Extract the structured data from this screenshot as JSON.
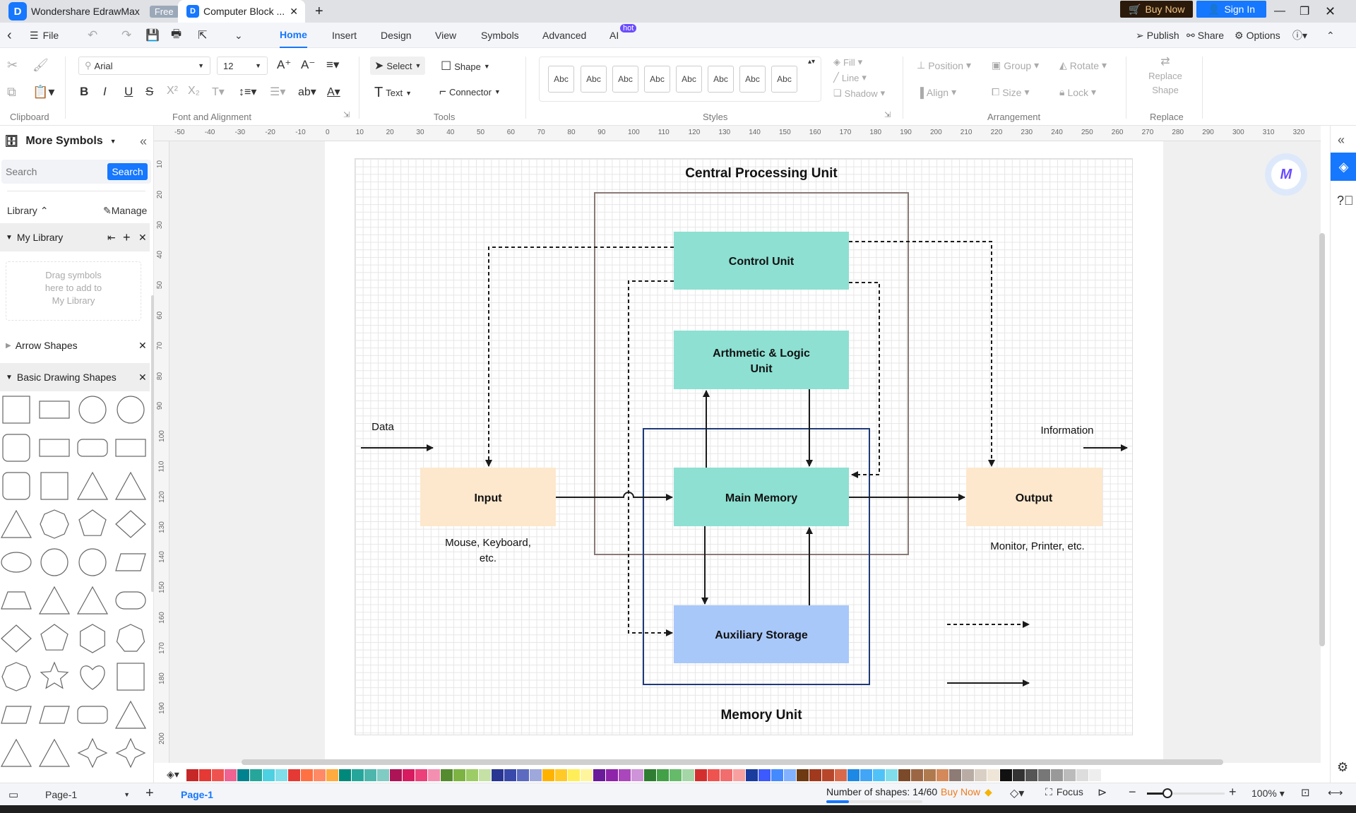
{
  "tabs": {
    "app": "Wondershare EdrawMax",
    "free_badge": "Free",
    "doc": "Computer Block ...",
    "buy": "Buy Now",
    "signin": "Sign In"
  },
  "menu": {
    "file": "File",
    "items": [
      "Home",
      "Insert",
      "Design",
      "View",
      "Symbols",
      "Advanced",
      "AI"
    ],
    "hot": "hot",
    "active": "Home",
    "publish": "Publish",
    "share": "Share",
    "options": "Options"
  },
  "ribbon": {
    "font": "Arial",
    "size": "12",
    "select": "Select",
    "shape": "Shape",
    "text": "Text",
    "connector": "Connector",
    "abc": "Abc",
    "fill": "Fill",
    "line": "Line",
    "shadow": "Shadow",
    "position": "Position",
    "group": "Group",
    "rotate": "Rotate",
    "align": "Align",
    "size_label": "Size",
    "lock": "Lock",
    "replace1": "Replace",
    "replace2": "Shape",
    "groups": {
      "clipboard": "Clipboard",
      "font": "Font and Alignment",
      "tools": "Tools",
      "styles": "Styles",
      "arrangement": "Arrangement",
      "replace": "Replace"
    }
  },
  "left": {
    "title": "More Symbols",
    "search_placeholder": "Search",
    "search_btn": "Search",
    "library": "Library",
    "manage": "Manage",
    "my_library": "My Library",
    "drop_hint": [
      "Drag symbols",
      "here to add to",
      "My Library"
    ],
    "arrow_shapes": "Arrow Shapes",
    "basic_shapes": "Basic Drawing Shapes"
  },
  "ruler": {
    "top": [
      -50,
      -40,
      -30,
      -20,
      -10,
      0,
      10,
      20,
      30,
      40,
      50,
      60,
      70,
      80,
      90,
      100,
      110,
      120,
      130,
      140,
      150,
      160,
      170,
      180,
      190,
      200,
      210,
      220,
      230,
      240,
      250,
      260,
      270,
      280,
      290,
      300,
      310,
      320
    ],
    "left": [
      10,
      20,
      30,
      40,
      50,
      60,
      70,
      80,
      90,
      100,
      110,
      120,
      130,
      140,
      150,
      160,
      170,
      180,
      190,
      200
    ]
  },
  "diagram": {
    "title": "Central Processing Unit",
    "control": "Control Unit",
    "alu": [
      "Arthmetic & Logic",
      "Unit"
    ],
    "main": "Main Memory",
    "aux": "Auxiliary Storage",
    "memory_unit": "Memory Unit",
    "input": "Input",
    "output": "Output",
    "input_desc": [
      "Mouse, Keyboard,",
      "etc."
    ],
    "output_desc": "Monitor, Printer, etc.",
    "data": "Data",
    "information": "Information",
    "colors": {
      "teal": "#8de0d2",
      "input": "#fde8cd",
      "aux": "#a8c8fa",
      "cpu_border": "#8a7a77",
      "mem_border": "#1f3a78"
    }
  },
  "palette": [
    "#c62828",
    "#e53935",
    "#ef5350",
    "#f06292",
    "#00838f",
    "#26a69a",
    "#4dd0e1",
    "#80deea",
    "#e53935",
    "#ff7043",
    "#ff8a65",
    "#ffab40",
    "#00897b",
    "#26a69a",
    "#4db6ac",
    "#80cbc4",
    "#ad1457",
    "#d81b60",
    "#ec407a",
    "#f48fb1",
    "#558b2f",
    "#7cb342",
    "#9ccc65",
    "#c5e1a5",
    "#283593",
    "#3949ab",
    "#5c6bc0",
    "#9fa8da",
    "#ffb300",
    "#ffca28",
    "#ffee58",
    "#fff59d",
    "#6a1b9a",
    "#8e24aa",
    "#ab47bc",
    "#ce93d8",
    "#2e7d32",
    "#43a047",
    "#66bb6a",
    "#a5d6a7",
    "#d32f2f",
    "#ef5350",
    "#f26d6d",
    "#f8a0a0",
    "#1a3c9e",
    "#3d5afe",
    "#448aff",
    "#82b1ff",
    "#6d3a12",
    "#a0391d",
    "#b8462a",
    "#d9694b",
    "#1e88e5",
    "#42a5f5",
    "#4fc3f7",
    "#80deea",
    "#7b4a2a",
    "#9c6644",
    "#b07a4f",
    "#d4895a",
    "#8d7b76",
    "#b8aca4",
    "#d9cfc4",
    "#efe6d8",
    "#111111",
    "#333333",
    "#555555",
    "#777777",
    "#999999",
    "#bbbbbb",
    "#dddddd",
    "#eeeeee"
  ],
  "status": {
    "page_sel": "Page-1",
    "page_tab": "Page-1",
    "shapes": "Number of shapes: 14/60",
    "shapes_fraction": 0.233,
    "buy": "Buy Now",
    "focus": "Focus",
    "zoom": "100%",
    "zoom_level": 0.1
  }
}
